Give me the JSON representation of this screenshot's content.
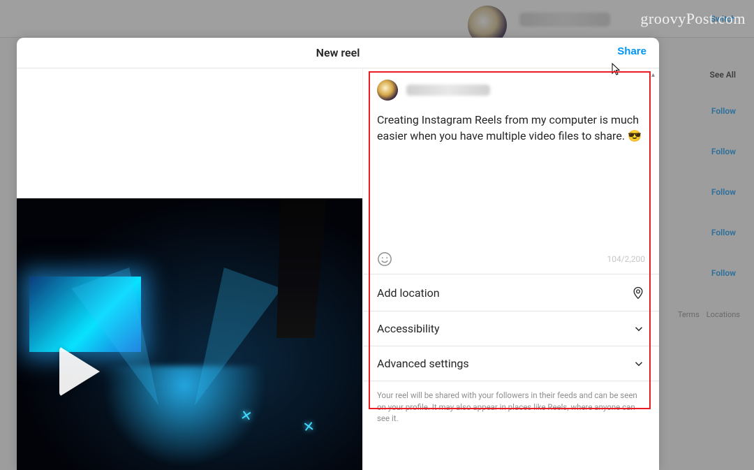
{
  "watermark": "groovyPost.com",
  "background": {
    "switch_label": "Switch",
    "see_all_label": "See All",
    "follow_label": "Follow",
    "footer_links": [
      "Terms",
      "Locations"
    ]
  },
  "modal": {
    "title": "New reel",
    "share_label": "Share",
    "caption_text": "Creating Instagram Reels from my computer is much easier when you have multiple video files to share. 😎",
    "char_count": "104/2,200",
    "sections": {
      "location_label": "Add location",
      "accessibility_label": "Accessibility",
      "advanced_label": "Advanced settings"
    },
    "disclaimer": "Your reel will be shared with your followers in their feeds and can be seen on your profile. It may also appear in places like Reels, where anyone can see it."
  }
}
